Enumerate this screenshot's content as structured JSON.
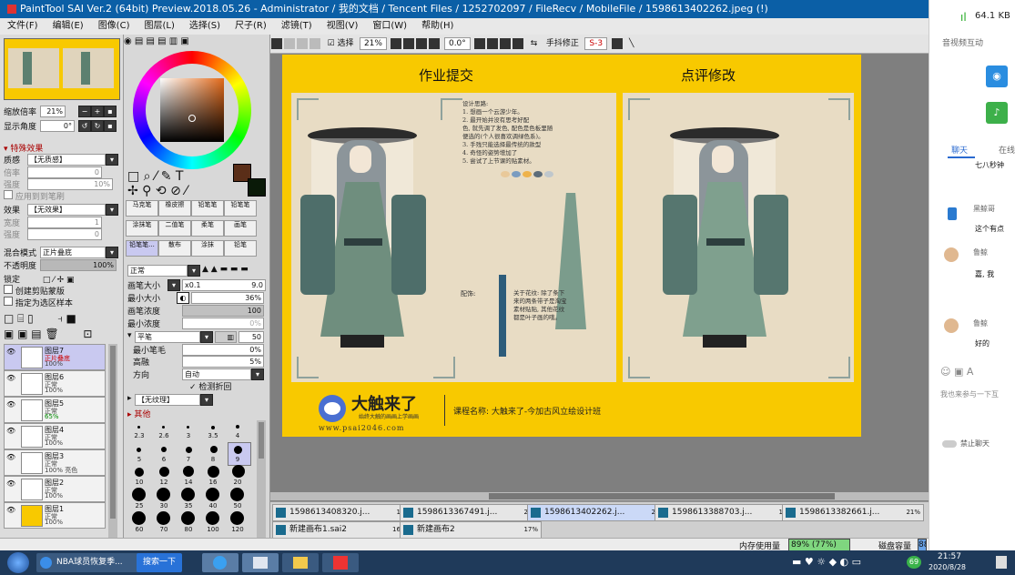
{
  "titlebar": {
    "title": "PaintTool SAI Ver.2 (64bit) Preview.2018.05.26 - Administrator / 我的文档 / Tencent Files / 1252702097 / FileRecv / MobileFile / 1598613402262.jpeg (!)"
  },
  "menu": [
    "文件(F)",
    "编辑(E)",
    "图像(C)",
    "图层(L)",
    "选择(S)",
    "尺子(R)",
    "滤镜(T)",
    "视图(V)",
    "窗口(W)",
    "帮助(H)"
  ],
  "nav": {
    "zoom_label": "缩放倍率",
    "zoom_value": "21%",
    "angle_label": "显示角度",
    "angle_value": "0°"
  },
  "effects": {
    "header": "▾ 特殊效果",
    "texture_label": "质感",
    "texture_value": "【无质感】",
    "scale_label": "倍率",
    "scale_value": "0",
    "strength_label": "强度",
    "strength_value": "10%",
    "apply_label": "应用到到笔刷",
    "effect_label": "效果",
    "effect_value": "【无效果】",
    "width_label": "宽度",
    "width_value": "1",
    "str2_label": "强度",
    "str2_value": "0"
  },
  "layer_props": {
    "blend_label": "混合模式",
    "blend_value": "正片叠底",
    "opacity_label": "不透明度",
    "opacity_value": "100%",
    "lock_label": "锁定",
    "clip_label": "创建剪贴蒙版",
    "sample_label": "指定为选区样本"
  },
  "layers": [
    {
      "name": "图层7",
      "mode": "正片叠底",
      "opacity": "100%"
    },
    {
      "name": "图层6",
      "mode": "正常",
      "opacity": "100%"
    },
    {
      "name": "图层5",
      "mode": "正常",
      "opacity": "65%"
    },
    {
      "name": "图层4",
      "mode": "正常",
      "opacity": "100%"
    },
    {
      "name": "图层3",
      "mode": "正常",
      "opacity": "100% 亮色"
    },
    {
      "name": "图层2",
      "mode": "正常",
      "opacity": "100%"
    },
    {
      "name": "图层1",
      "mode": "正常",
      "opacity": "100%"
    }
  ],
  "brushes": [
    "马克笔",
    "橡皮擦",
    "铅笔笔",
    "铅笔笔",
    "涂抹笔",
    "二值笔",
    "柔笔",
    "画笔",
    "铅笔笔...",
    "散布",
    "涂抹",
    "铅笔"
  ],
  "tool_settings": {
    "mode_value": "正常",
    "brush_size_label": "画笔大小",
    "brush_size_mult": "x0.1",
    "brush_size_value": "9.0",
    "min_size_label": "最小大小",
    "min_size_value": "36%",
    "density_label": "画笔浓度",
    "density_value": "100",
    "min_density_label": "最小浓度",
    "min_density_value": "0%",
    "shape_value": "平笔",
    "shape_num": "50",
    "min_hair_label": "最小笔毛",
    "min_hair_value": "0%",
    "hair_height_label": "高融",
    "hair_height_value": "5%",
    "direction_label": "方向",
    "direction_value": "自动",
    "detect_fold_label": "检测折回",
    "texture_value": "【无纹理】",
    "other_label": "▸ 其他"
  },
  "brush_sizes": [
    "2.3",
    "2.6",
    "3",
    "3.5",
    "4",
    "5",
    "6",
    "7",
    "8",
    "9",
    "10",
    "12",
    "14",
    "16",
    "20",
    "25",
    "30",
    "35",
    "40",
    "50",
    "60",
    "70",
    "80",
    "100",
    "120"
  ],
  "canvas_toolbar": {
    "select_label": "选择",
    "zoom": "21%",
    "angle": "0.0°",
    "stabilizer_label": "手抖修正",
    "stabilizer_value": "S-3"
  },
  "artwork": {
    "left_title": "作业提交",
    "right_title": "点评修改",
    "design_notes": [
      "设计思路:",
      "1. 想画一个云游少年。",
      "2. 最开始并没有思考好配",
      "色, 就先调了发色, 配色是色板里随",
      "便选的(个人很喜欢调绿色系)。",
      "3. 手残只能选择最传统的款型",
      "4. 奇怪的姿势增加了",
      "5. 尝试了上节课的贴素材。"
    ],
    "colors_label": "配饰:",
    "pattern_note": [
      "关于花纹: 除了条下",
      "来的两条带子是淘宝",
      "素材贴贴, 其他花纹",
      "都是叶子画的哦。"
    ],
    "logo_text": "大触来了",
    "logo_sub": "始终大触的画画上学画画",
    "logo_url": "www.psai2046.com",
    "course_text": "课程名称: 大触来了-今加古风立绘设计班"
  },
  "tabs": [
    {
      "name": "1598613408320.j...",
      "pct": "18%"
    },
    {
      "name": "1598613367491.j...",
      "pct": "25%"
    },
    {
      "name": "1598613402262.j...",
      "pct": "21%"
    },
    {
      "name": "1598613388703.j...",
      "pct": "15%"
    },
    {
      "name": "1598613382661.j...",
      "pct": "21%"
    },
    {
      "name": "新建画布1.sai2",
      "pct": "168%"
    },
    {
      "name": "新建画布2",
      "pct": "17%"
    }
  ],
  "status": {
    "memory_label": "内存使用量",
    "memory_value": "89% (77%)",
    "disk_label": "磁盘容量",
    "disk_value": "88%"
  },
  "taskbar": {
    "browser_label": "NBA球员恢复季...",
    "search_label": "搜索一下",
    "time": "21:57",
    "date": "2020/8/28",
    "badge": "69"
  },
  "rightpane": {
    "signal": "64.1 KB",
    "video_label": "音视频互动",
    "tab_chat": "聊天",
    "tab_other": "在线",
    "messages": [
      "七八秒钟",
      "黑鲸哥",
      "这个有点",
      "鲁鲸",
      "嘉, 我",
      "鲁鲸",
      "好的"
    ],
    "input_placeholder": "我也来参与一下互",
    "mute_label": "禁止聊天"
  },
  "colors": {
    "accent_yellow": "#f8c900",
    "canvas_beige": "#e8dcc4",
    "title_blue": "#0b5fa6"
  }
}
